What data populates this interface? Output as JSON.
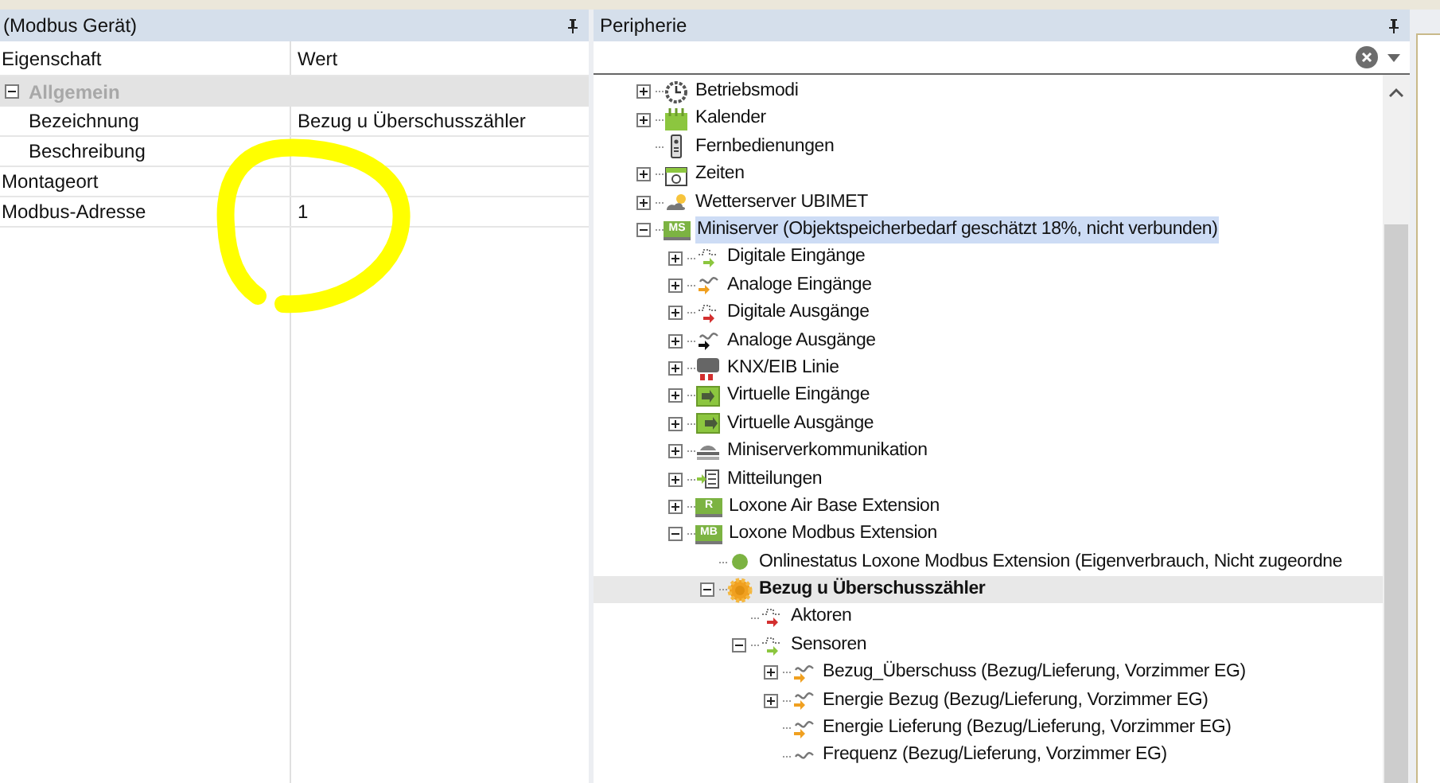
{
  "properties_panel": {
    "title": "(Modbus Gerät)",
    "columns": [
      "Eigenschaft",
      "Wert"
    ],
    "rows": [
      {
        "kind": "group",
        "label": "Allgemein",
        "expanded": true,
        "children": [
          {
            "label": "Bezeichnung",
            "value": "Bezug u Überschusszähler"
          },
          {
            "label": "Beschreibung"
          }
        ]
      },
      {
        "kind": "property",
        "label": "Montageort"
      },
      {
        "kind": "property",
        "label": "Modbus-Adresse",
        "value": "1"
      }
    ]
  },
  "peripherie_panel": {
    "title": "Peripherie",
    "tree": [
      {
        "label": "Betriebsmodi",
        "kind": "clock",
        "expanded": false,
        "selected": false,
        "focused": false
      },
      {
        "label": "Kalender",
        "kind": "calendar",
        "expanded": false,
        "selected": false,
        "focused": false
      },
      {
        "label": "Fernbedienungen",
        "kind": "remote",
        "selected": false,
        "focused": false
      },
      {
        "label": "Zeiten",
        "kind": "timer",
        "expanded": false,
        "selected": false,
        "focused": false
      },
      {
        "label": "Wetterserver UBIMET",
        "kind": "weather",
        "expanded": false,
        "selected": false,
        "focused": false
      },
      {
        "label": "Miniserver (Objektspeicherbedarf geschätzt 18%, nicht verbunden)",
        "kind": "module",
        "badge": "MS",
        "expanded": true,
        "selected": true,
        "focused": false,
        "children": [
          {
            "label": "Digitale Eingänge",
            "kind": "digital-in",
            "expanded": false,
            "selected": false,
            "focused": false
          },
          {
            "label": "Analoge Eingänge",
            "kind": "analog-in",
            "expanded": false,
            "selected": false,
            "focused": false
          },
          {
            "label": "Digitale Ausgänge",
            "kind": "digital-out",
            "expanded": false,
            "selected": false,
            "focused": false
          },
          {
            "label": "Analoge Ausgänge",
            "kind": "analog-out",
            "expanded": false,
            "selected": false,
            "focused": false
          },
          {
            "label": "KNX/EIB Linie",
            "kind": "knx",
            "expanded": false,
            "selected": false,
            "focused": false
          },
          {
            "label": "Virtuelle Eingänge",
            "kind": "virtual-in",
            "expanded": false,
            "selected": false,
            "focused": false
          },
          {
            "label": "Virtuelle Ausgänge",
            "kind": "virtual-out",
            "expanded": false,
            "selected": false,
            "focused": false
          },
          {
            "label": "Miniserverkommunikation",
            "kind": "network",
            "expanded": false,
            "selected": false,
            "focused": false
          },
          {
            "label": "Mitteilungen",
            "kind": "messages",
            "expanded": false,
            "selected": false,
            "focused": false
          },
          {
            "label": "Loxone Air Base Extension",
            "kind": "module",
            "badge": "R",
            "expanded": false,
            "selected": false,
            "focused": false
          },
          {
            "label": "Loxone Modbus Extension",
            "kind": "module",
            "badge": "MB",
            "expanded": true,
            "selected": false,
            "focused": false,
            "children": [
              {
                "label": "Onlinestatus Loxone Modbus Extension (Eigenverbrauch, Nicht zugeordne",
                "kind": "status",
                "selected": false,
                "focused": false
              },
              {
                "label": "Bezug u Überschusszähler",
                "kind": "device",
                "expanded": true,
                "selected": false,
                "focused": true,
                "children": [
                  {
                    "label": "Aktoren",
                    "kind": "digital-out",
                    "selected": false,
                    "focused": false
                  },
                  {
                    "label": "Sensoren",
                    "kind": "digital-in",
                    "expanded": true,
                    "selected": false,
                    "focused": false,
                    "children": [
                      {
                        "label": "Bezug_Überschuss (Bezug/Lieferung, Vorzimmer EG)",
                        "kind": "analog-in",
                        "expanded": false,
                        "selected": false,
                        "focused": false
                      },
                      {
                        "label": "Energie Bezug (Bezug/Lieferung, Vorzimmer EG)",
                        "kind": "analog-in",
                        "expanded": false,
                        "selected": false,
                        "focused": false
                      },
                      {
                        "label": "Energie Lieferung (Bezug/Lieferung, Vorzimmer EG)",
                        "kind": "analog-in",
                        "selected": false,
                        "focused": false
                      },
                      {
                        "label": "Frequenz (Bezug/Lieferung, Vorzimmer EG)",
                        "kind": "analog-out-plain",
                        "selected": false,
                        "focused": false
                      }
                    ]
                  }
                ]
              }
            ]
          }
        ]
      }
    ]
  }
}
